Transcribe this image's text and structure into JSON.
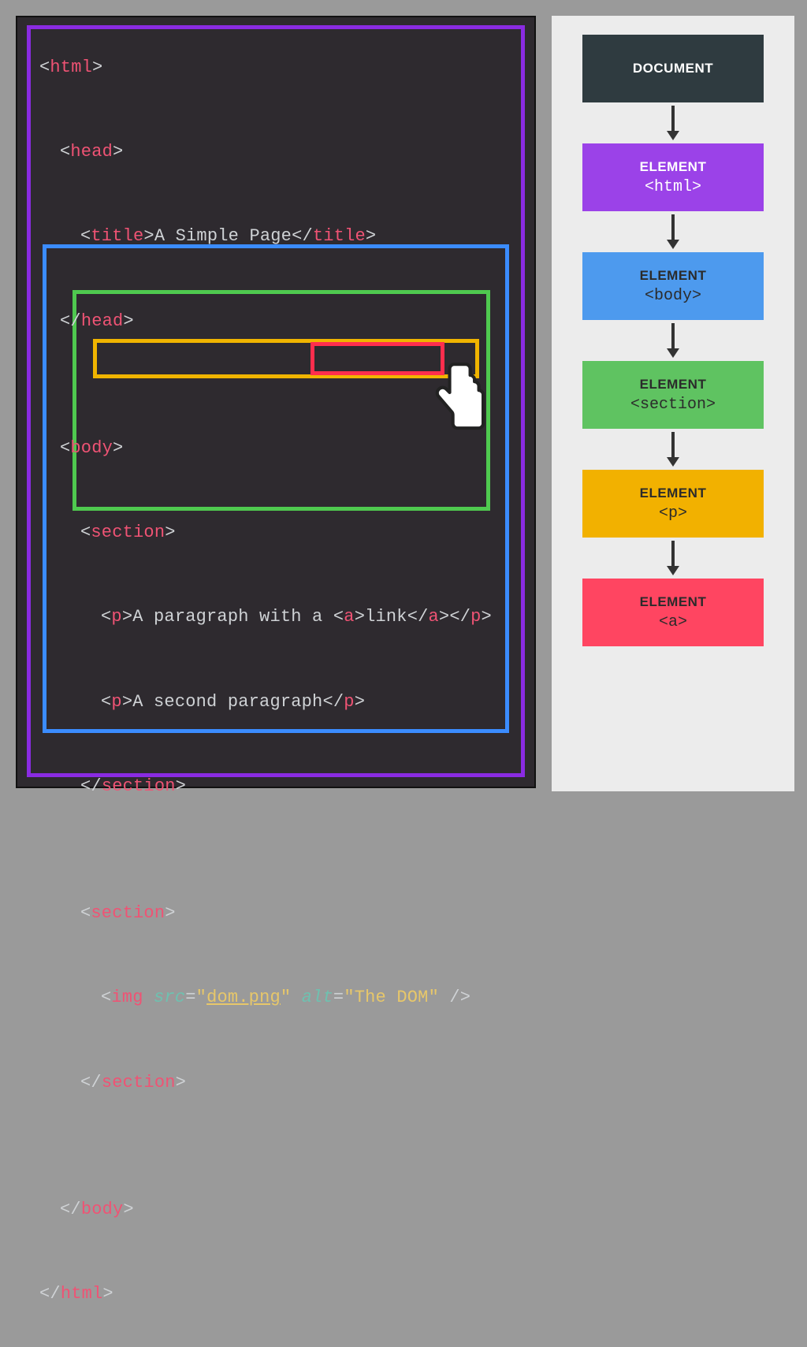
{
  "code": {
    "title_text": "A Simple Page",
    "p1_text": "A paragraph with a ",
    "link_text": "link",
    "p2_text": "A second paragraph",
    "img_src": "dom.png",
    "img_alt": "The DOM"
  },
  "tree": {
    "nodes": [
      {
        "type": "DOCUMENT",
        "tag": ""
      },
      {
        "type": "ELEMENT",
        "tag": "<html>"
      },
      {
        "type": "ELEMENT",
        "tag": "<body>"
      },
      {
        "type": "ELEMENT",
        "tag": "<section>"
      },
      {
        "type": "ELEMENT",
        "tag": "<p>"
      },
      {
        "type": "ELEMENT",
        "tag": "<a>"
      }
    ]
  },
  "chart_data": {
    "type": "tree",
    "title": "DOM element hierarchy",
    "nodes": [
      {
        "id": "document",
        "label": "DOCUMENT",
        "color": "#2f3b40"
      },
      {
        "id": "html",
        "label": "ELEMENT <html>",
        "color": "#9b42e8"
      },
      {
        "id": "body",
        "label": "ELEMENT <body>",
        "color": "#4d9aee"
      },
      {
        "id": "section",
        "label": "ELEMENT <section>",
        "color": "#5fc361"
      },
      {
        "id": "p",
        "label": "ELEMENT <p>",
        "color": "#f2b100"
      },
      {
        "id": "a",
        "label": "ELEMENT <a>",
        "color": "#ff4561"
      }
    ],
    "edges": [
      [
        "document",
        "html"
      ],
      [
        "html",
        "body"
      ],
      [
        "body",
        "section"
      ],
      [
        "section",
        "p"
      ],
      [
        "p",
        "a"
      ]
    ]
  }
}
